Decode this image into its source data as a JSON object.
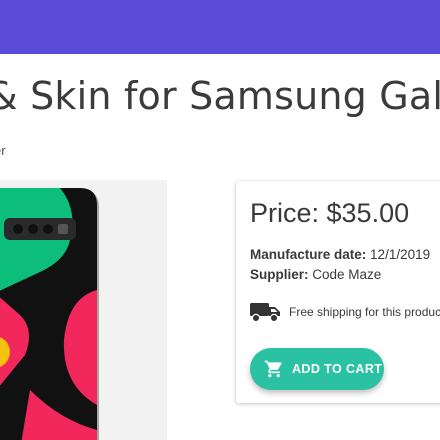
{
  "header": {
    "bar_color": "#5a4bdb"
  },
  "product": {
    "title": "& Skin for Samsung Gal",
    "breadcrumb": "er",
    "price_label": "Price: $35.00",
    "manufacture_label": "Manufacture date:",
    "manufacture_value": "12/1/2019",
    "supplier_label": "Supplier:",
    "supplier_value": "Code Maze",
    "shipping_text": "Free shipping for this produc",
    "shipping_icon": "truck-icon"
  },
  "actions": {
    "add_to_cart_label": "ADD TO CART",
    "add_to_cart_icon": "cart-icon",
    "accent_color": "#2bc2a4"
  }
}
